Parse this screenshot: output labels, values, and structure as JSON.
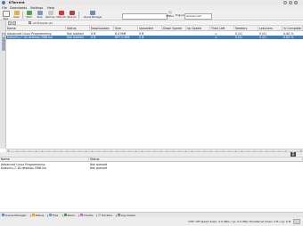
{
  "window": {
    "title": "KTorrent"
  },
  "menu": [
    "File",
    "Downloads",
    "Settings",
    "Help"
  ],
  "toolbar": {
    "buttons": [
      "New",
      "Open",
      "Start",
      "Stop",
      "Remove",
      "Start All",
      "Stop All"
    ],
    "queue_label": "Queue Manager",
    "search_label": "IPFilter",
    "engine_label": "Engine:",
    "engine_value": "isohunt.com"
  },
  "sidebar": {
    "tab_label": "Downloads"
  },
  "subbar": {
    "filter_label": "All Torrents (2)"
  },
  "table": {
    "columns": [
      "Name",
      "Status",
      "Downloaded",
      "Size",
      "Uploaded",
      "Down Speed",
      "Up Speed",
      "Time Left",
      "Seeders",
      "Leechers",
      "% Complete"
    ],
    "rows": [
      {
        "name": "Advanced Linux Programming",
        "status": "Not started",
        "downloaded": "0 B",
        "size": "6.4 MiB",
        "uploaded": "0 B",
        "down_speed": "",
        "up_speed": "",
        "time_left": "∞",
        "seeders": "0 (0)",
        "leechers": "0 (0)",
        "complete": "0.00 %"
      },
      {
        "name": "Kubuntu-7.10-desktop-i386.iso",
        "status": "Not started",
        "downloaded": "0 B",
        "size": "697.0 MiB",
        "uploaded": "0 B",
        "down_speed": "",
        "up_speed": "",
        "time_left": "∞",
        "seeders": "0 (0)",
        "leechers": "0 (0)",
        "complete": "0.00 %"
      }
    ]
  },
  "queue": {
    "columns": [
      "Name",
      "Status"
    ],
    "rows": [
      {
        "name": "Advanced Linux Programming",
        "status": "Not queued"
      },
      {
        "name": "Kubuntu-7.10-desktop-i386.iso",
        "status": "Not queued"
      }
    ]
  },
  "bottom_tabs": [
    "Queue Manager",
    "Status",
    "Files",
    "Peers",
    "Chunks",
    "Trackers",
    "Log Viewer"
  ],
  "status": {
    "text": "DHT: Off Speed down: 0.0 KB/s / up: 0.0 KB/s Transferred down: 0 B / up: 0 B"
  },
  "colors": {
    "selection": "#3d7ec3",
    "toolbar_bg": "#efefef"
  }
}
